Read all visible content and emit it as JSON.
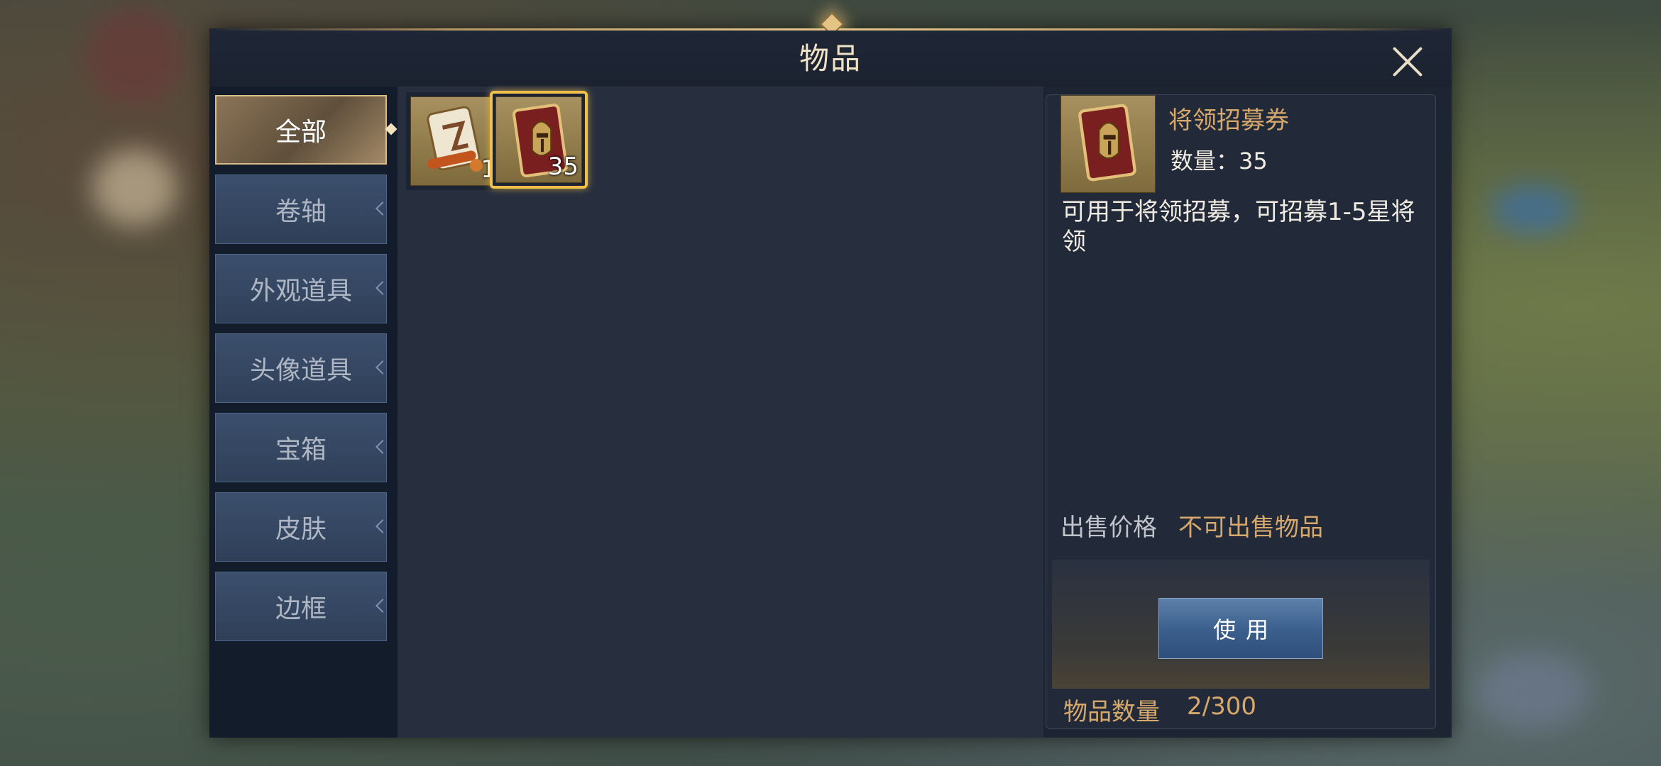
{
  "window": {
    "title": "物品"
  },
  "tabs": [
    {
      "label": "全部",
      "active": true
    },
    {
      "label": "卷轴"
    },
    {
      "label": "外观道具"
    },
    {
      "label": "头像道具"
    },
    {
      "label": "宝箱"
    },
    {
      "label": "皮肤"
    },
    {
      "label": "边框"
    }
  ],
  "items": [
    {
      "icon": "scroll-icon",
      "count": "1"
    },
    {
      "icon": "knight-card-icon",
      "count": "35",
      "selected": true
    }
  ],
  "detail": {
    "icon": "knight-card-icon",
    "name": "将领招募券",
    "quantity_text": "数量：35",
    "description": "可用于将领招募，可招募1-5星将领",
    "sell_price_label": "出售价格",
    "sell_price_value": "不可出售物品",
    "use_button": "使用"
  },
  "footer": {
    "item_count_label": "物品数量",
    "item_count_value": "2/300"
  },
  "colors": {
    "accent_gold": "#d6a86c",
    "selected_border": "#f0c04a",
    "tab_active": "#8c7558",
    "tab_inactive": "#3b4f6c"
  }
}
